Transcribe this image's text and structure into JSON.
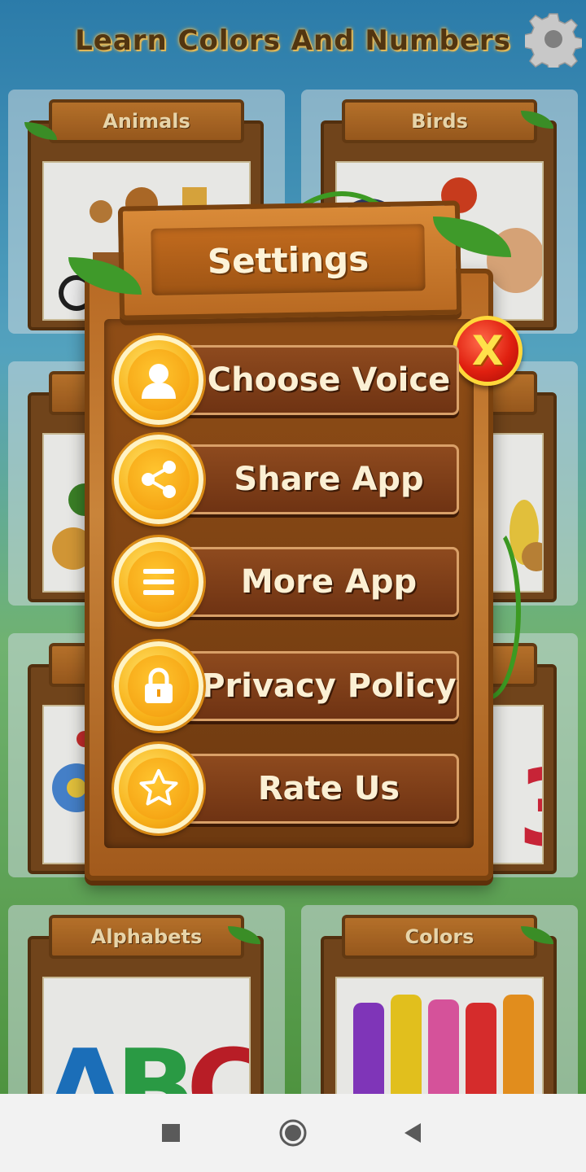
{
  "app": {
    "title": "Learn Colors And Numbers",
    "gear_icon": "gear-icon"
  },
  "cards": [
    {
      "label": "Animals"
    },
    {
      "label": "Birds"
    },
    {
      "label": ""
    },
    {
      "label": ""
    },
    {
      "label": ""
    },
    {
      "label": ""
    },
    {
      "label": "Alphabets"
    },
    {
      "label": "Colors"
    }
  ],
  "dialog": {
    "title": "Settings",
    "close_label": "X",
    "items": [
      {
        "label": "Choose Voice",
        "icon": "user-icon"
      },
      {
        "label": "Share App",
        "icon": "share-icon"
      },
      {
        "label": "More App",
        "icon": "menu-icon"
      },
      {
        "label": "Privacy Policy",
        "icon": "lock-icon"
      },
      {
        "label": "Rate Us",
        "icon": "star-icon"
      }
    ]
  },
  "navbar": {
    "icons": [
      "recents-icon",
      "home-icon",
      "back-icon"
    ]
  },
  "colors": {
    "wood": "#b86a24",
    "badge": "#f8b21a",
    "close": "#e02010"
  }
}
